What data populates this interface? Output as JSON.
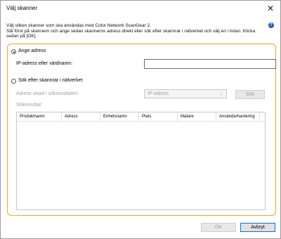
{
  "window": {
    "title": "Välj skanner",
    "close_glyph": "✕"
  },
  "description": "Välj vilken skanner som ska användas med Color Network ScanGear 2.\nSlå först på skannern och ange sedan skannerns adress direkt eller sök efter skannrar i nätverket och välj en i listan. Klicka sedan på [OK].",
  "help_glyph": "?",
  "option_address": {
    "label": "Ange adress",
    "selected": true,
    "field_label": "IP-adress eller värdnamn:",
    "field_value": ""
  },
  "option_search": {
    "label": "Sök efter skannrar i nätverket",
    "selected": false,
    "address_shown_label": "Adress visad i sökresultaten:",
    "address_type_value": "IP-adress",
    "search_button": "Sök",
    "results_label": "Sökresultat:"
  },
  "results_table": {
    "columns": [
      "Produktnamn",
      "Adress",
      "Enhetsnamn",
      "Plats",
      "Matare",
      "Användarhantering"
    ]
  },
  "footer": {
    "ok_label": "OK",
    "cancel_label": "Avbryt"
  },
  "colors": {
    "highlight": "#f5a623",
    "help_icon": "#1f5fc8",
    "primary_border": "#0078d7"
  }
}
